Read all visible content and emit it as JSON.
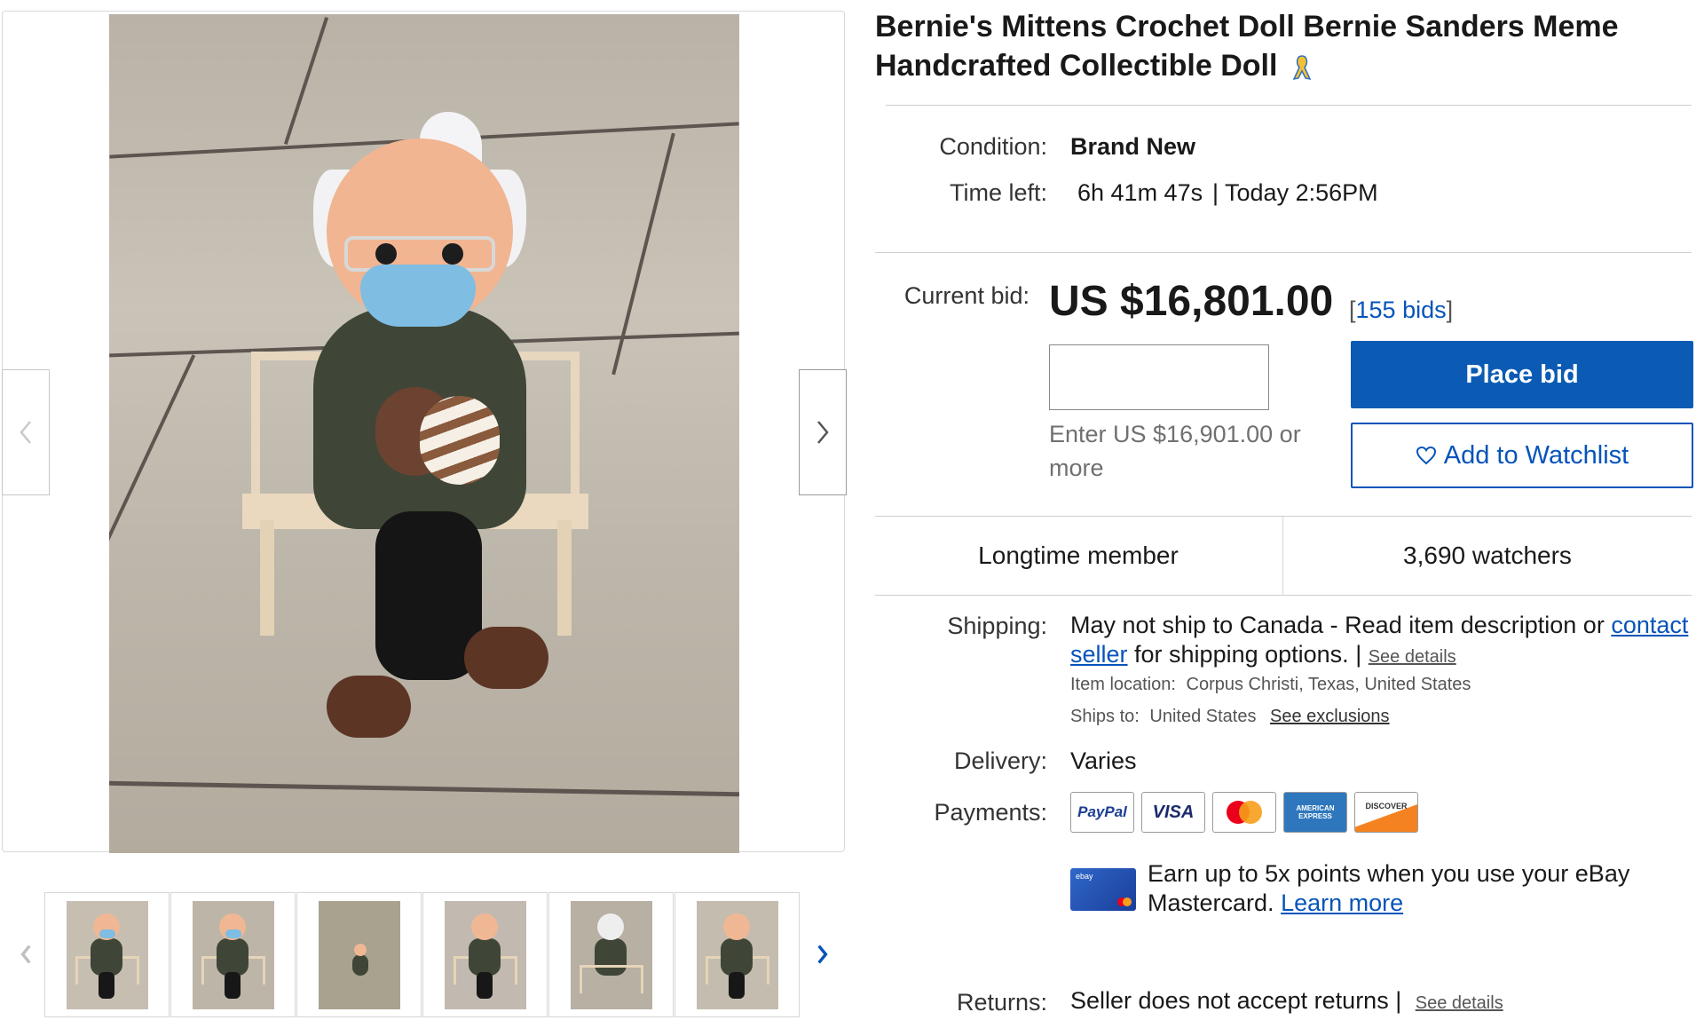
{
  "listing": {
    "title": "Bernie's Mittens Crochet Doll Bernie Sanders Meme Handcrafted Collectible Doll",
    "ribbon_icon": "awareness-ribbon-icon",
    "condition_label": "Condition:",
    "condition_value": "Brand New",
    "time_left_label": "Time left:",
    "time_left_value": "6h 41m 47s",
    "end_time": "| Today 2:56PM"
  },
  "bidding": {
    "current_bid_label": "Current bid:",
    "price": "US $16,801.00",
    "bids_open": "[",
    "bids_link": "155 bids",
    "bids_close": "]",
    "input_value": "",
    "hint": "Enter US $16,901.00 or more",
    "place_bid_label": "Place bid",
    "watchlist_label": "Add to Watchlist"
  },
  "stats": {
    "member": "Longtime member",
    "watchers": "3,690 watchers"
  },
  "shipping": {
    "label": "Shipping:",
    "text_before": "May not ship to Canada - Read item description or ",
    "contact_link": "contact seller",
    "text_after": " for shipping options. | ",
    "see_details": "See details",
    "item_location_label": "Item location:",
    "item_location": "Corpus Christi, Texas, United States",
    "ships_to_label": "Ships to:",
    "ships_to": "United States",
    "see_exclusions": "See exclusions"
  },
  "delivery": {
    "label": "Delivery:",
    "value": "Varies"
  },
  "payments": {
    "label": "Payments:",
    "methods": [
      "PayPal",
      "VISA",
      "Mastercard",
      "American Express",
      "Discover"
    ],
    "paypal_text": "PayPal",
    "visa_text": "VISA",
    "discover_text": "DISCOVER",
    "amex_text": "AMERICAN EXPRESS"
  },
  "promo": {
    "text": "Earn up to 5x points when you use your eBay Mastercard.",
    "link": "Learn more",
    "card_text": "ebay"
  },
  "returns": {
    "label": "Returns:",
    "value": "Seller does not accept returns |",
    "see_details": "See details"
  },
  "colors": {
    "accent_blue": "#0b5bb5",
    "link_blue": "#0654ba",
    "text": "#191919"
  }
}
